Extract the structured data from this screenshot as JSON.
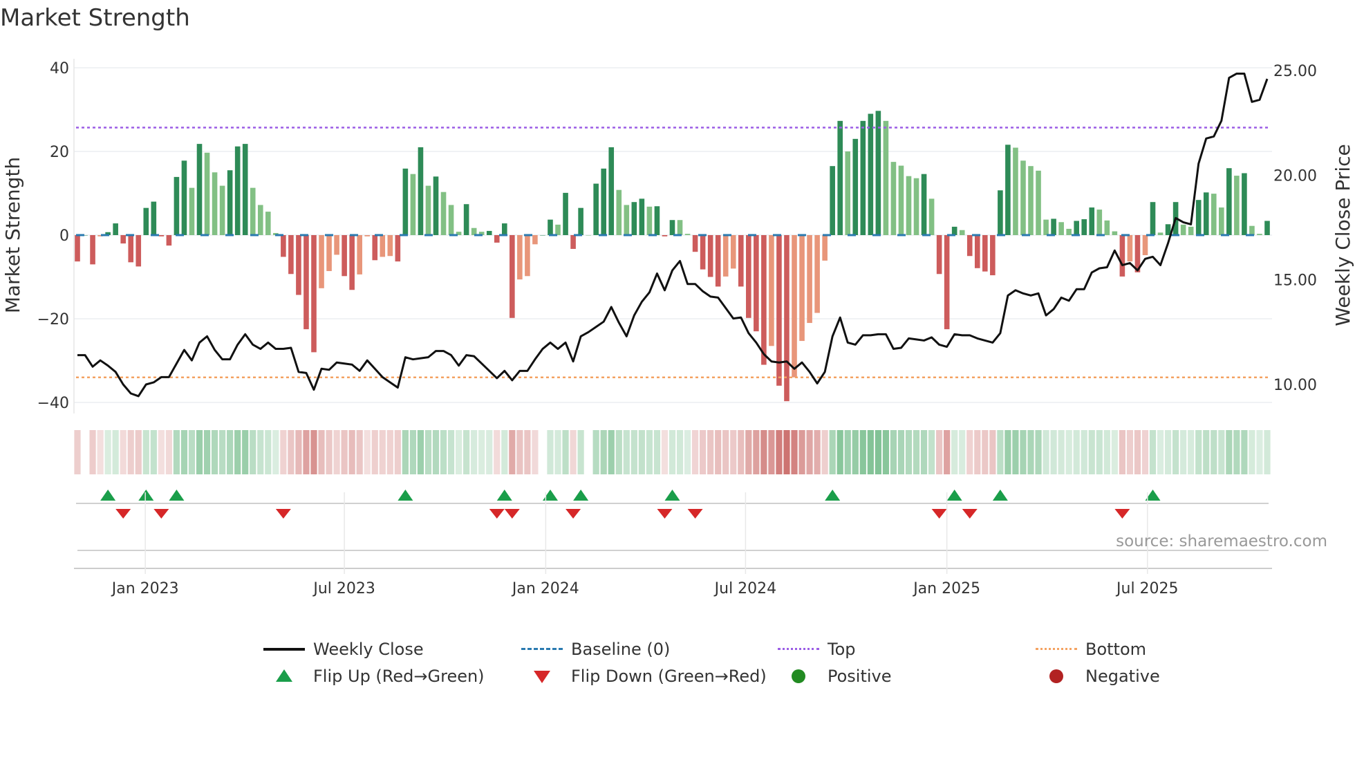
{
  "title": "Market Strength",
  "source": "source: sharemaestro.com",
  "chart_data": {
    "type": "bar+line",
    "title": "Market Strength",
    "ylabel": "Market Strength",
    "y2label": "Weekly Close Price",
    "ylim": [
      -42,
      43
    ],
    "y2ticks": [
      "25.00",
      "20.00",
      "15.00",
      "10.00"
    ],
    "y2values": [
      25,
      20,
      15,
      10
    ],
    "yticks": [
      "40",
      "20",
      "0",
      "−20",
      "−40"
    ],
    "yvalues": [
      40,
      20,
      0,
      -20,
      -40
    ],
    "top_level": 25.7,
    "bottom_level": -34.0,
    "xticks": [
      {
        "label": "Jan 2023",
        "week": 8.9
      },
      {
        "label": "Jul 2023",
        "week": 35.0
      },
      {
        "label": "Jan 2024",
        "week": 61.4
      },
      {
        "label": "Jul 2024",
        "week": 87.6
      },
      {
        "label": "Jan 2025",
        "week": 114.0
      },
      {
        "label": "Jul 2025",
        "week": 140.3
      }
    ],
    "strength": [
      -6.3,
      0,
      -7,
      -0.3,
      0.7,
      2.8,
      -2,
      -6.5,
      -7.5,
      6.5,
      8,
      -0.3,
      -2.5,
      13.9,
      17.8,
      11.3,
      21.8,
      19.7,
      15,
      11.8,
      15.5,
      21.2,
      21.8,
      11.3,
      7.2,
      5.6,
      0.5,
      -5.2,
      -9.3,
      -14.3,
      -22.5,
      -28,
      -12.7,
      -8.6,
      -4.7,
      -9.8,
      -13.1,
      -9.4,
      -0.3,
      -6,
      -5.2,
      -5,
      -6.3,
      15.9,
      14.6,
      21,
      11.8,
      14,
      10.3,
      7.2,
      0.8,
      7.4,
      1.7,
      0.8,
      1,
      -1.8,
      2.8,
      -19.8,
      -10.6,
      -9.8,
      -2.2,
      0,
      3.7,
      2.5,
      10.1,
      -3.3,
      6.5,
      0,
      12.3,
      15.9,
      21,
      10.8,
      7.2,
      7.9,
      8.7,
      6.8,
      6.9,
      -0.3,
      3.6,
      3.6,
      0.3,
      -4,
      -8.2,
      -10,
      -12.3,
      -9.9,
      -8,
      -12.3,
      -19.8,
      -23,
      -31,
      -26.5,
      -36,
      -39.7,
      -34,
      -25.3,
      -21,
      -18.6,
      -6.1,
      16.5,
      27.3,
      20,
      23,
      27.3,
      29,
      29.7,
      27.3,
      17.5,
      16.6,
      14.1,
      13.6,
      14.6,
      8.7,
      -9.3,
      -22.5,
      2,
      1.2,
      -5,
      -7.9,
      -8.7,
      -9.6,
      10.7,
      21.6,
      20.9,
      17.8,
      16.5,
      15.4,
      3.7,
      3.9,
      3.1,
      1.5,
      3.4,
      3.8,
      6.6,
      6.1,
      3.5,
      0.9,
      -9.9,
      -6.3,
      -8.9,
      -4.8,
      7.9,
      0.6,
      2.6,
      7.9,
      2.5,
      2,
      8.4,
      10.2,
      9.9,
      6.6,
      16,
      14.2,
      14.8,
      2.2,
      0.3,
      3.4
    ],
    "weekly_close": [
      11.4,
      11.4,
      10.85,
      11.15,
      10.9,
      10.6,
      10.0,
      9.57,
      9.44,
      10.0,
      10.1,
      10.35,
      10.35,
      11.0,
      11.65,
      11.15,
      12.0,
      12.3,
      11.65,
      11.2,
      11.2,
      11.9,
      12.4,
      11.9,
      11.7,
      12.0,
      11.7,
      11.7,
      11.75,
      10.6,
      10.55,
      9.75,
      10.75,
      10.7,
      11.05,
      11.0,
      10.95,
      10.65,
      11.15,
      10.75,
      10.35,
      10.1,
      9.85,
      11.3,
      11.2,
      11.25,
      11.3,
      11.6,
      11.6,
      11.4,
      10.9,
      11.4,
      11.35,
      11.0,
      10.65,
      10.3,
      10.65,
      10.2,
      10.65,
      10.65,
      11.2,
      11.7,
      12.0,
      11.7,
      12.0,
      11.1,
      12.3,
      12.5,
      12.75,
      13.0,
      13.7,
      12.95,
      12.3,
      13.3,
      13.95,
      14.4,
      15.3,
      14.5,
      15.45,
      15.9,
      14.8,
      14.8,
      14.45,
      14.2,
      14.15,
      13.65,
      13.15,
      13.2,
      12.45,
      12.0,
      11.45,
      11.1,
      11.05,
      11.1,
      10.75,
      11.05,
      10.6,
      10.05,
      10.6,
      12.3,
      13.2,
      12.0,
      11.9,
      12.35,
      12.35,
      12.4,
      12.4,
      11.7,
      11.75,
      12.2,
      12.15,
      12.1,
      12.25,
      11.9,
      11.8,
      12.4,
      12.35,
      12.35,
      12.2,
      12.1,
      12.0,
      12.45,
      14.25,
      14.5,
      14.35,
      14.25,
      14.35,
      13.3,
      13.6,
      14.15,
      14.0,
      14.55,
      14.55,
      15.35,
      15.55,
      15.6,
      16.4,
      15.7,
      15.8,
      15.45,
      16.0,
      16.1,
      15.7,
      16.75,
      17.95,
      17.75,
      17.65,
      20.55,
      21.75,
      21.85,
      22.6,
      24.65,
      24.85,
      24.85,
      23.5,
      23.6,
      24.6
    ],
    "legend": {
      "weekly_close": "Weekly Close",
      "baseline": "Baseline (0)",
      "top": "Top",
      "bottom": "Bottom",
      "flip_up": "Flip Up (Red→Green)",
      "flip_down": "Flip Down (Green→Red)",
      "positive": "Positive",
      "negative": "Negative"
    },
    "legend_placement": "bottom",
    "colors": {
      "pos_strong": "#2e8b57",
      "pos_weak": "#82c084",
      "neg_strong": "#cd5c5c",
      "neg_weak": "#e8967a",
      "baseline": "#2a7ab0",
      "top": "#9b5de5",
      "bottom": "#f4a261",
      "line": "#111111",
      "flip_up": "#1a9e4a",
      "flip_down": "#d62728",
      "positive": "#228b22",
      "negative": "#b22222"
    }
  }
}
